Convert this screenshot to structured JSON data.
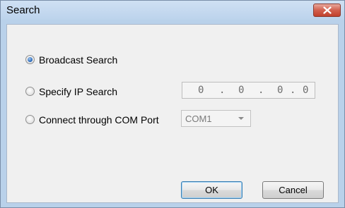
{
  "window": {
    "title": "Search"
  },
  "icons": {
    "close": "close-icon"
  },
  "options": [
    {
      "label": "Broadcast Search",
      "selected": true
    },
    {
      "label": "Specify IP Search",
      "selected": false
    },
    {
      "label": "Connect through COM Port",
      "selected": false
    }
  ],
  "ip": {
    "octet1": "0",
    "octet2": "0",
    "octet3": "0",
    "octet4": "0",
    "sep": "."
  },
  "com": {
    "selected": "COM1"
  },
  "buttons": {
    "ok": "OK",
    "cancel": "Cancel"
  }
}
